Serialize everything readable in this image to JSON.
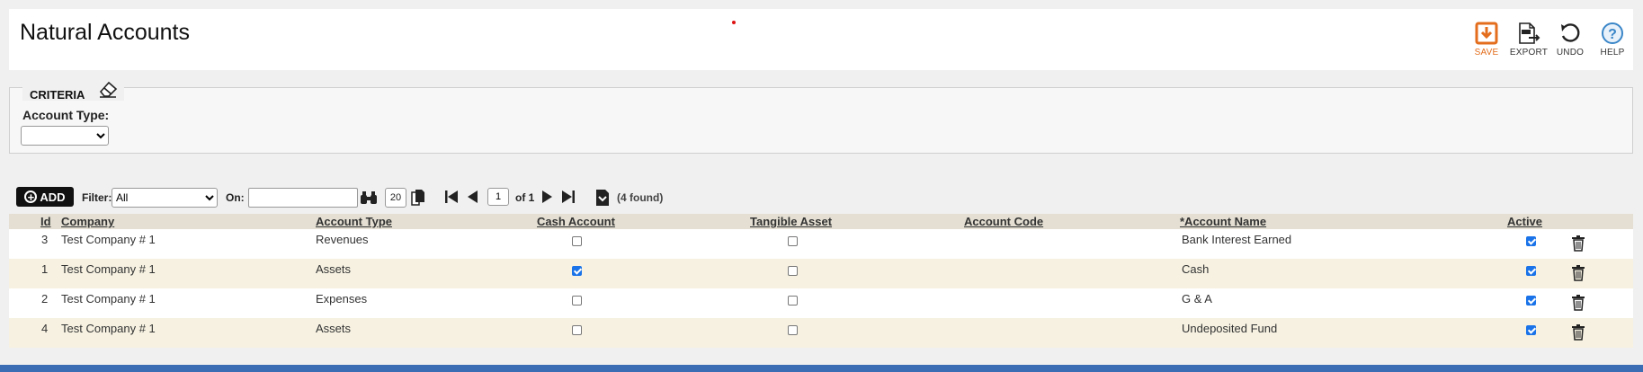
{
  "header": {
    "title": "Natural Accounts",
    "toolbar": {
      "save": "SAVE",
      "export": "EXPORT",
      "undo": "UNDO",
      "help": "HELP"
    }
  },
  "criteria": {
    "title": "CRITERIA",
    "account_type_label": "Account Type:",
    "account_type_value": ""
  },
  "grid_toolbar": {
    "add_label": "ADD",
    "filter_label": "Filter:",
    "filter_value": "All",
    "on_label": "On:",
    "on_value": "",
    "page_size": "20",
    "page_number": "1",
    "of_text": "of 1",
    "found_text": "(4 found)"
  },
  "columns": {
    "id": "Id",
    "company": "Company",
    "account_type": "Account Type",
    "cash_account": "Cash Account",
    "tangible_asset": "Tangible Asset",
    "account_code": "Account Code",
    "account_name": "*Account Name",
    "active": "Active"
  },
  "rows": [
    {
      "id": "3",
      "company": "Test Company # 1",
      "account_type": "Revenues",
      "cash_account": false,
      "tangible_asset": false,
      "account_code": "",
      "account_name": "Bank Interest Earned",
      "active": true
    },
    {
      "id": "1",
      "company": "Test Company # 1",
      "account_type": "Assets",
      "cash_account": true,
      "tangible_asset": false,
      "account_code": "",
      "account_name": "Cash",
      "active": true
    },
    {
      "id": "2",
      "company": "Test Company # 1",
      "account_type": "Expenses",
      "cash_account": false,
      "tangible_asset": false,
      "account_code": "",
      "account_name": "G & A",
      "active": true
    },
    {
      "id": "4",
      "company": "Test Company # 1",
      "account_type": "Assets",
      "cash_account": false,
      "tangible_asset": false,
      "account_code": "",
      "account_name": "Undeposited Fund",
      "active": true
    }
  ],
  "colors": {
    "save_accent": "#e36d1c",
    "help_accent": "#3a86c8",
    "header_row": "#e4dfd2",
    "alt_row": "#f6f1e1",
    "checkbox_checked": "#1a73e8",
    "bottom_bar": "#3a6db4"
  },
  "icons": [
    "save-icon",
    "export-icon",
    "undo-icon",
    "help-icon",
    "eraser-icon",
    "binoculars-icon",
    "copy-icon",
    "first-page-icon",
    "prev-page-icon",
    "next-page-icon",
    "last-page-icon",
    "download-icon",
    "trash-icon"
  ]
}
